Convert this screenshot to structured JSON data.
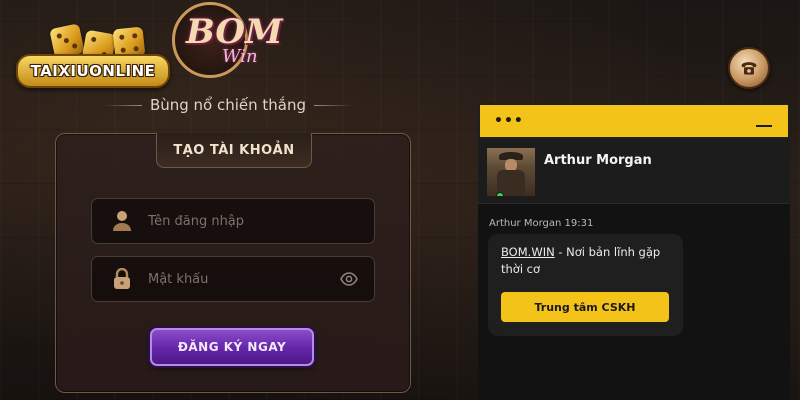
{
  "brand": {
    "taixiu_logo_text": "TAIXIUONLINE",
    "bom_logo_text": "BOM",
    "bom_logo_subtext": "Win"
  },
  "tagline": "Bùng nổ chiến thắng",
  "register_form": {
    "title": "TẠO TÀI KHOẢN",
    "username_placeholder": "Tên đăng nhập",
    "password_placeholder": "Mật khẩu",
    "submit_label": "ĐĂNG KÝ NGAY"
  },
  "chat": {
    "menu_label": "•••",
    "agent_name": "Arthur Morgan",
    "message_meta": "Arthur Morgan 19:31",
    "message_link": "BOM.WIN",
    "message_text": " - Nơi bản lĩnh gặp thời cơ",
    "cta_label": "Trung tâm CSKH"
  },
  "icons": {
    "phone": "phone-icon",
    "user": "user-icon",
    "lock": "lock-icon",
    "eye": "eye-icon"
  },
  "colors": {
    "chat_accent": "#f3c319",
    "submit_purple": "#6426a8",
    "gold": "#c89661"
  }
}
